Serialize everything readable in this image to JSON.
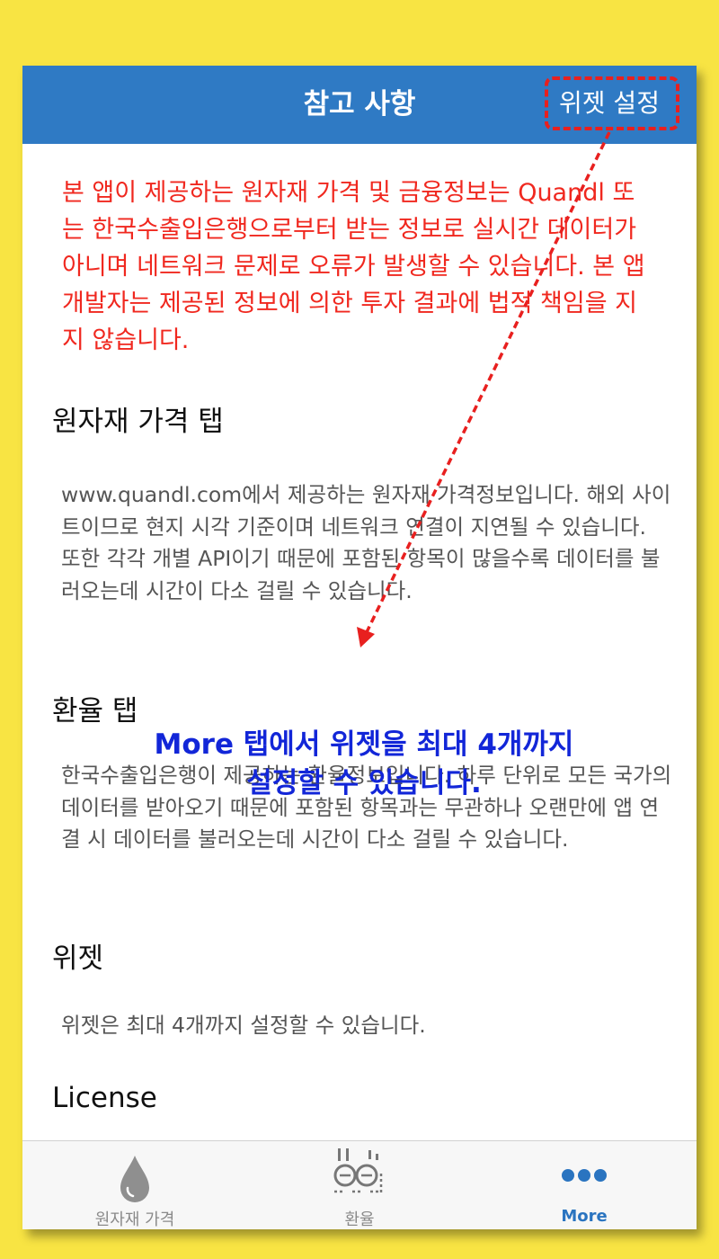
{
  "navbar": {
    "title": "참고 사항",
    "action_label": "위젯 설정"
  },
  "notice": "본 앱이 제공하는 원자재 가격 및 금융정보는 Quandl 또는 한국수출입은행으로부터 받는 정보로 실시간 데이터가 아니며 네트워크 문제로 오류가 발생할 수 있습니다. 본 앱 개발자는 제공된 정보에 의한 투자 결과에 법적 책임을 지지 않습니다.",
  "sections": [
    {
      "title": "원자재 가격 탭",
      "body": "www.quandl.com에서 제공하는 원자재 가격정보입니다. 해외 사이트이므로 현지 시각 기준이며 네트워크 연결이 지연될 수 있습니다. 또한 각각 개별 API이기 때문에 포함된 항목이 많을수록 데이터를 불러오는데 시간이 다소 걸릴 수 있습니다."
    },
    {
      "title": "환율 탭",
      "body": "한국수출입은행이 제공하는 환율정보입니다. 하루 단위로 모든 국가의 데이터를 받아오기 때문에 포함된 항목과는 무관하나 오랜만에 앱 연결 시 데이터를 불러오는데 시간이 다소 걸릴 수 있습니다."
    },
    {
      "title": "위젯",
      "body": "위젯은 최대 4개까지 설정할 수 있습니다."
    },
    {
      "title": "License",
      "body": ""
    }
  ],
  "annotation": {
    "line1": "More 탭에서 위젯을 최대 4개까지",
    "line2": "설정할 수 있습니다."
  },
  "tabbar": {
    "items": [
      {
        "label": "원자재 가격",
        "icon": "drop-icon",
        "active": false
      },
      {
        "label": "환율",
        "icon": "exchange-icon",
        "active": false
      },
      {
        "label": "More",
        "icon": "more-dots-icon",
        "active": true
      }
    ]
  },
  "colors": {
    "background": "#f8e443",
    "navbar": "#2f7ac4",
    "notice_text": "#f0281f",
    "annotation_text": "#1226d8",
    "highlight": "#e8201f",
    "active_tab": "#2a74c0"
  }
}
